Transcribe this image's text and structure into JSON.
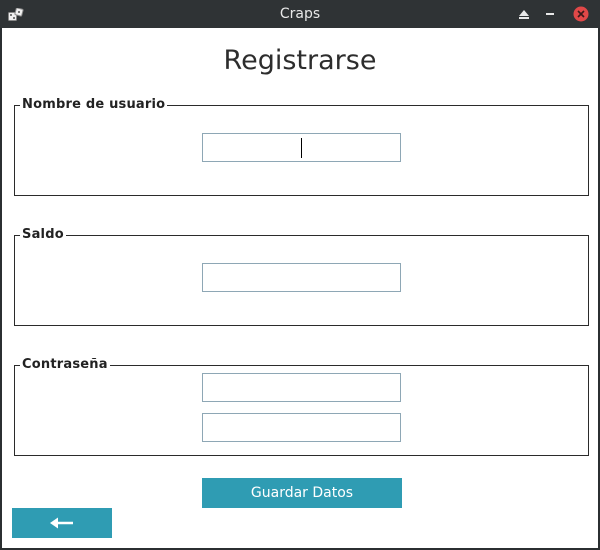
{
  "window": {
    "title": "Craps",
    "icons": [
      "dice-icon",
      "eject-icon",
      "minimize-icon",
      "close-icon"
    ]
  },
  "form": {
    "heading": "Registrarse",
    "username": {
      "legend": "Nombre de usuario",
      "value": ""
    },
    "balance": {
      "legend": "Saldo",
      "value": ""
    },
    "password": {
      "legend": "Contraseña",
      "value": "",
      "confirm_value": ""
    },
    "save_label": "Guardar Datos",
    "back_icon": "arrow-left-icon"
  },
  "colors": {
    "accent": "#2f9cb3",
    "close": "#e04848",
    "titlebar": "#2f3335"
  }
}
